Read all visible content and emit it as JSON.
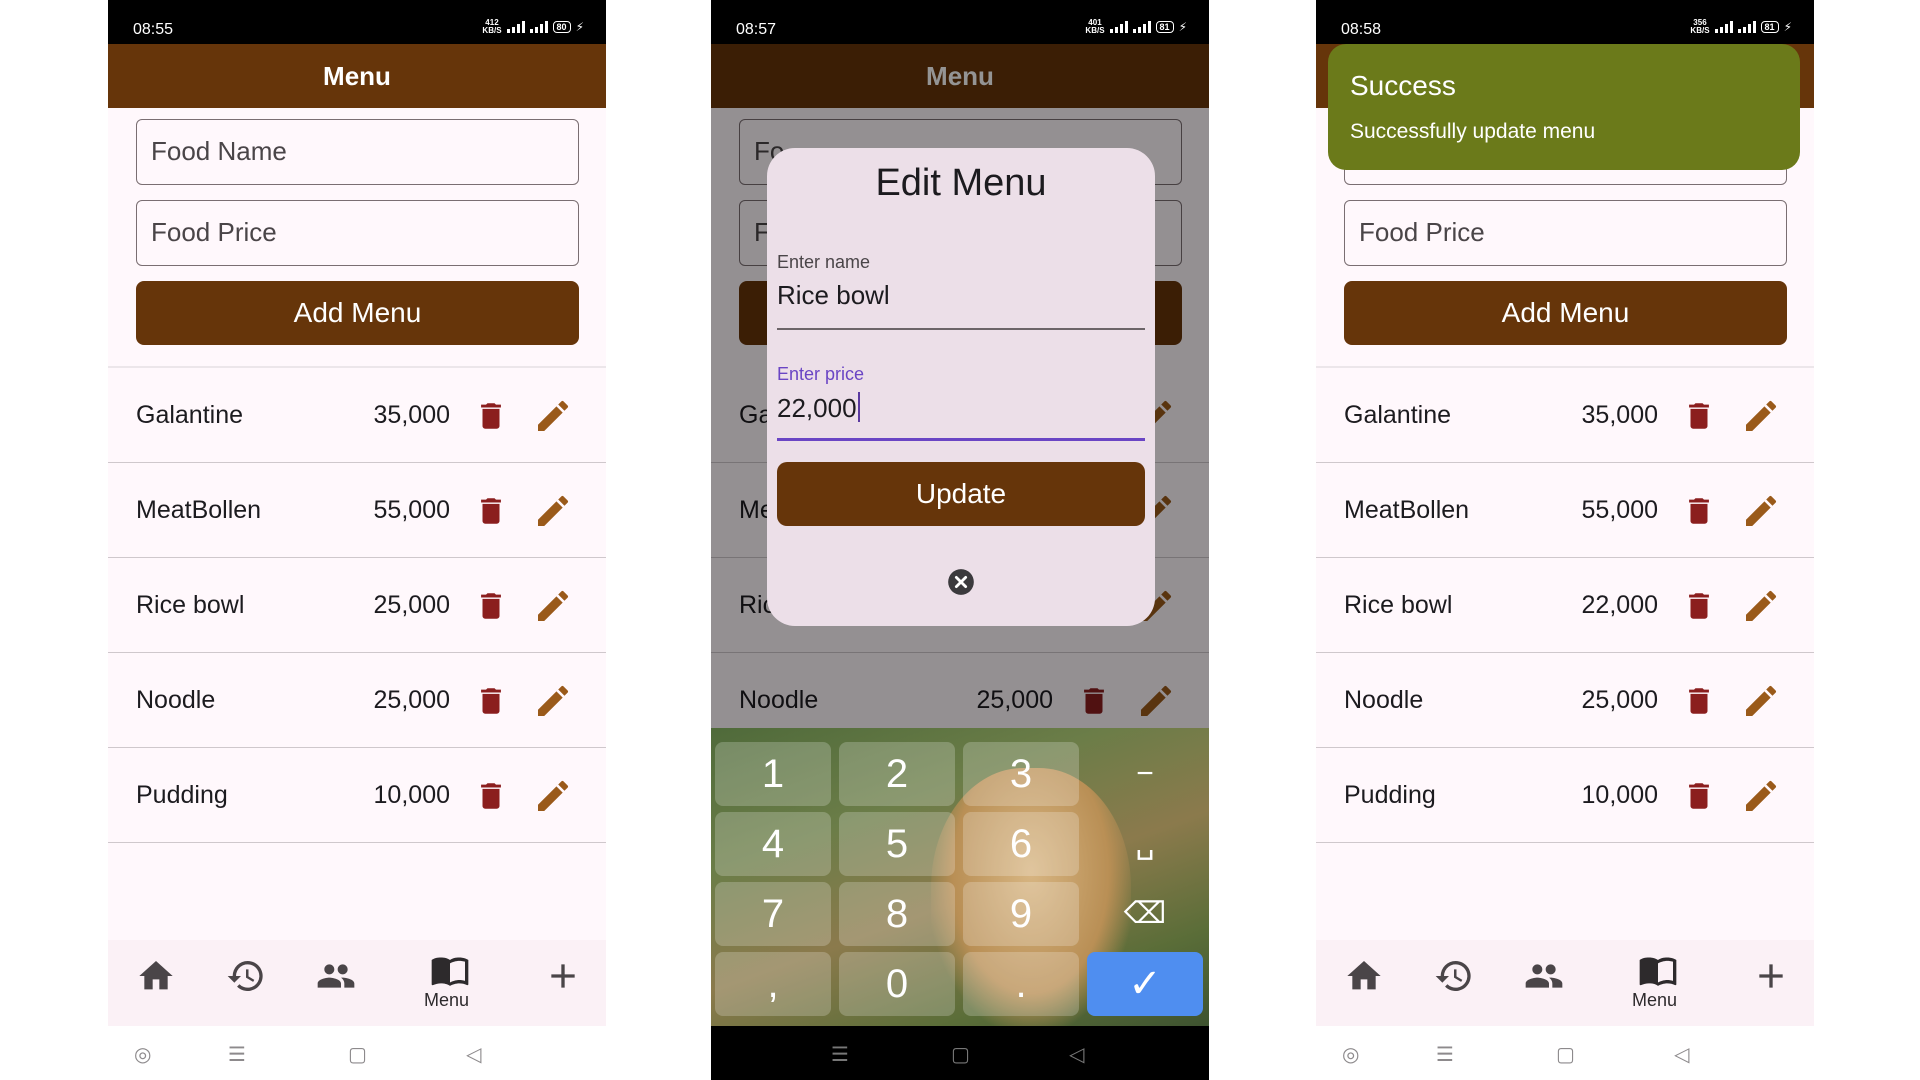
{
  "colors": {
    "brand_brown": "#66350a",
    "trash_red": "#8b1e1e",
    "pencil_brown": "#9a5a1a",
    "toast_green": "#6b7a1a",
    "focus_purple": "#6a45c4",
    "keyboard_ok_blue": "#4f8ef0"
  },
  "screens": [
    {
      "status": {
        "time": "08:55",
        "speed": "412",
        "speed_unit": "KB/S",
        "battery": "80"
      },
      "appbar_title": "Menu",
      "food_name_placeholder": "Food Name",
      "food_price_placeholder": "Food Price",
      "add_button": "Add Menu",
      "items": [
        {
          "name": "Galantine",
          "price": "35,000"
        },
        {
          "name": "MeatBollen",
          "price": "55,000"
        },
        {
          "name": "Rice bowl",
          "price": "25,000"
        },
        {
          "name": "Noodle",
          "price": "25,000"
        },
        {
          "name": "Pudding",
          "price": "10,000"
        }
      ],
      "nav": {
        "menu_label": "Menu"
      }
    },
    {
      "status": {
        "time": "08:57",
        "speed": "401",
        "speed_unit": "KB/S",
        "battery": "81"
      },
      "appbar_title": "Menu",
      "background_row_noodle": {
        "name": "Noodle",
        "price": "25,000"
      },
      "background_partials": {
        "field1": "Fo",
        "field2": "F",
        "row1": "Ga",
        "row2": "Me",
        "row3": "Ric"
      },
      "dialog": {
        "title": "Edit Menu",
        "name_label": "Enter name",
        "name_value": "Rice bowl",
        "price_label": "Enter price",
        "price_value": "22,000",
        "update_button": "Update"
      },
      "keyboard": {
        "keys": [
          "1",
          "2",
          "3",
          "4",
          "5",
          "6",
          "7",
          "8",
          "9",
          ",",
          "0",
          "."
        ],
        "minus": "−"
      }
    },
    {
      "status": {
        "time": "08:58",
        "speed": "356",
        "speed_unit": "KB/S",
        "battery": "81"
      },
      "toast": {
        "title": "Success",
        "message": "Successfully update menu"
      },
      "food_price_placeholder": "Food Price",
      "add_button": "Add Menu",
      "items": [
        {
          "name": "Galantine",
          "price": "35,000"
        },
        {
          "name": "MeatBollen",
          "price": "55,000"
        },
        {
          "name": "Rice bowl",
          "price": "22,000"
        },
        {
          "name": "Noodle",
          "price": "25,000"
        },
        {
          "name": "Pudding",
          "price": "10,000"
        }
      ],
      "nav": {
        "menu_label": "Menu"
      }
    }
  ],
  "icons": {
    "delete": "trash-icon",
    "edit": "pencil-icon",
    "home": "home-icon",
    "history": "history-icon",
    "users": "users-icon",
    "menu": "menu-book-icon",
    "add": "plus-icon",
    "close": "close-circle-icon"
  }
}
